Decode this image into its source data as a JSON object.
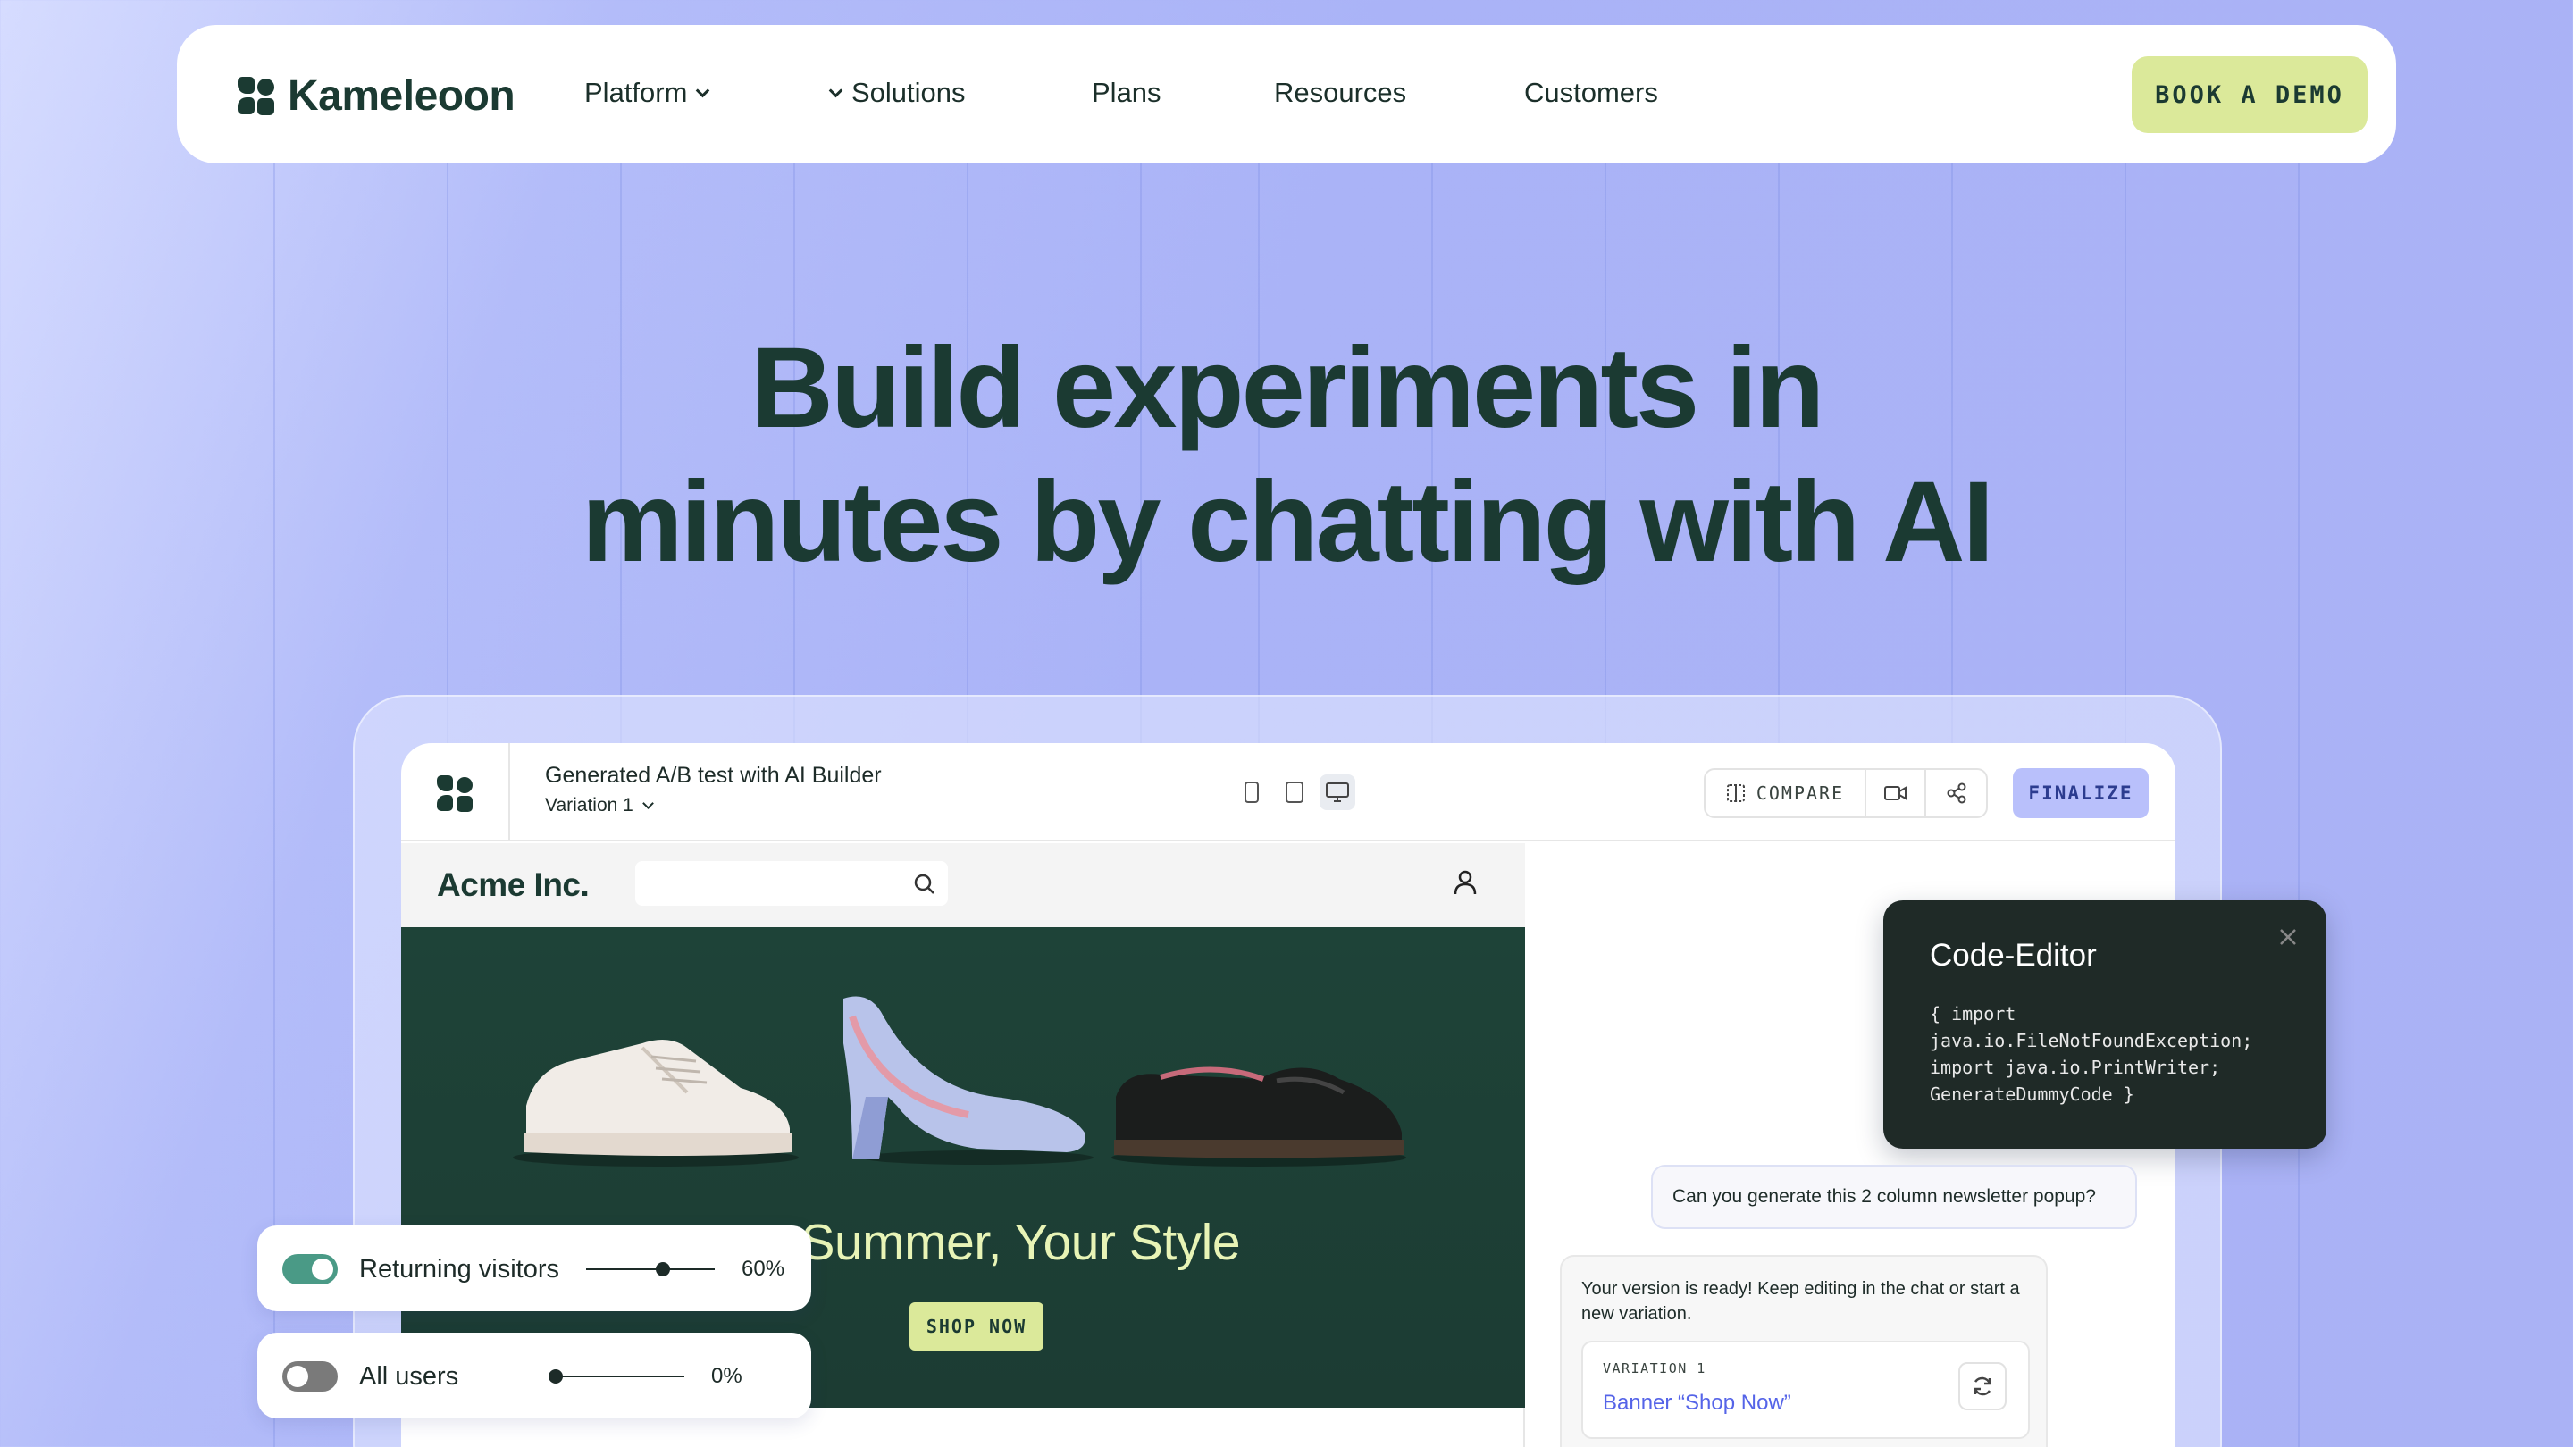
{
  "nav": {
    "brand": "Kameleoon",
    "items": [
      {
        "label": "Platform"
      },
      {
        "label": "Solutions"
      },
      {
        "label": "Plans"
      },
      {
        "label": "Resources"
      },
      {
        "label": "Customers"
      }
    ],
    "cta": "BOOK A DEMO"
  },
  "hero": {
    "line1": "Build experiments in",
    "line2": "minutes by chatting with AI"
  },
  "app": {
    "title": "Generated A/B test with AI Builder",
    "variation": "Variation 1",
    "compare_label": "COMPARE",
    "finalize_label": "FINALIZE"
  },
  "store": {
    "name": "Acme Inc.",
    "banner_title": "Your Summer, Your Style",
    "shop_button": "SHOP NOW"
  },
  "code_editor": {
    "title": "Code-Editor",
    "lines": [
      "{ import",
      "java.io.FileNotFoundException;",
      "import java.io.PrintWriter;",
      "GenerateDummyCode }"
    ]
  },
  "chat": {
    "question": "Can you generate this 2 column newsletter popup?",
    "answer": "Your version is ready! Keep editing in the chat or start a new variation.",
    "variation_label": "VARIATION 1",
    "variation_value": "Banner “Shop Now”"
  },
  "audience": [
    {
      "label": "Returning visitors",
      "percent": "60%",
      "value": 0.6,
      "enabled": true
    },
    {
      "label": "All users",
      "percent": "0%",
      "value": 0.0,
      "enabled": false
    }
  ],
  "colors": {
    "brand_dark": "#1b3a32",
    "cta_lime": "#dbe99a",
    "accent_blue": "#5564e8",
    "toggle_on": "#4a9a86",
    "toggle_off": "#7a7a7a"
  }
}
